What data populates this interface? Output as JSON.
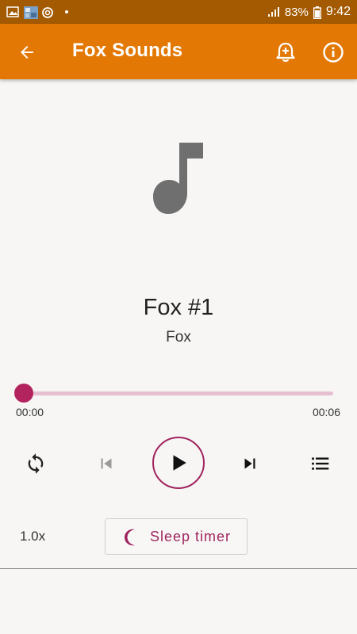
{
  "status_bar": {
    "battery": "83%",
    "time": "9:42",
    "icons": [
      "image-icon",
      "thumbnail-icon",
      "sync-icon",
      "dot-icon",
      "signal-icon",
      "battery-icon"
    ]
  },
  "app_bar": {
    "title": "Fox Sounds",
    "back_icon": "arrow-back-icon",
    "alarm_icon": "add-alarm-icon",
    "info_icon": "info-icon"
  },
  "player": {
    "artwork_icon": "music-note-icon",
    "track_title": "Fox #1",
    "artist": "Fox",
    "progress": 0.0,
    "elapsed": "00:00",
    "duration": "00:06",
    "controls": {
      "repeat_icon": "repeat-icon",
      "previous_icon": "skip-previous-icon",
      "play_icon": "play-icon",
      "next_icon": "skip-next-icon",
      "queue_icon": "queue-list-icon"
    },
    "speed": "1.0x",
    "sleep_timer_label": "Sleep timer",
    "sleep_timer_icon": "moon-icon"
  },
  "colors": {
    "status_bar": "#a45a00",
    "app_bar": "#e37804",
    "accent": "#a0245e",
    "seek_track": "#e6bfd1",
    "background": "#f7f6f5"
  }
}
